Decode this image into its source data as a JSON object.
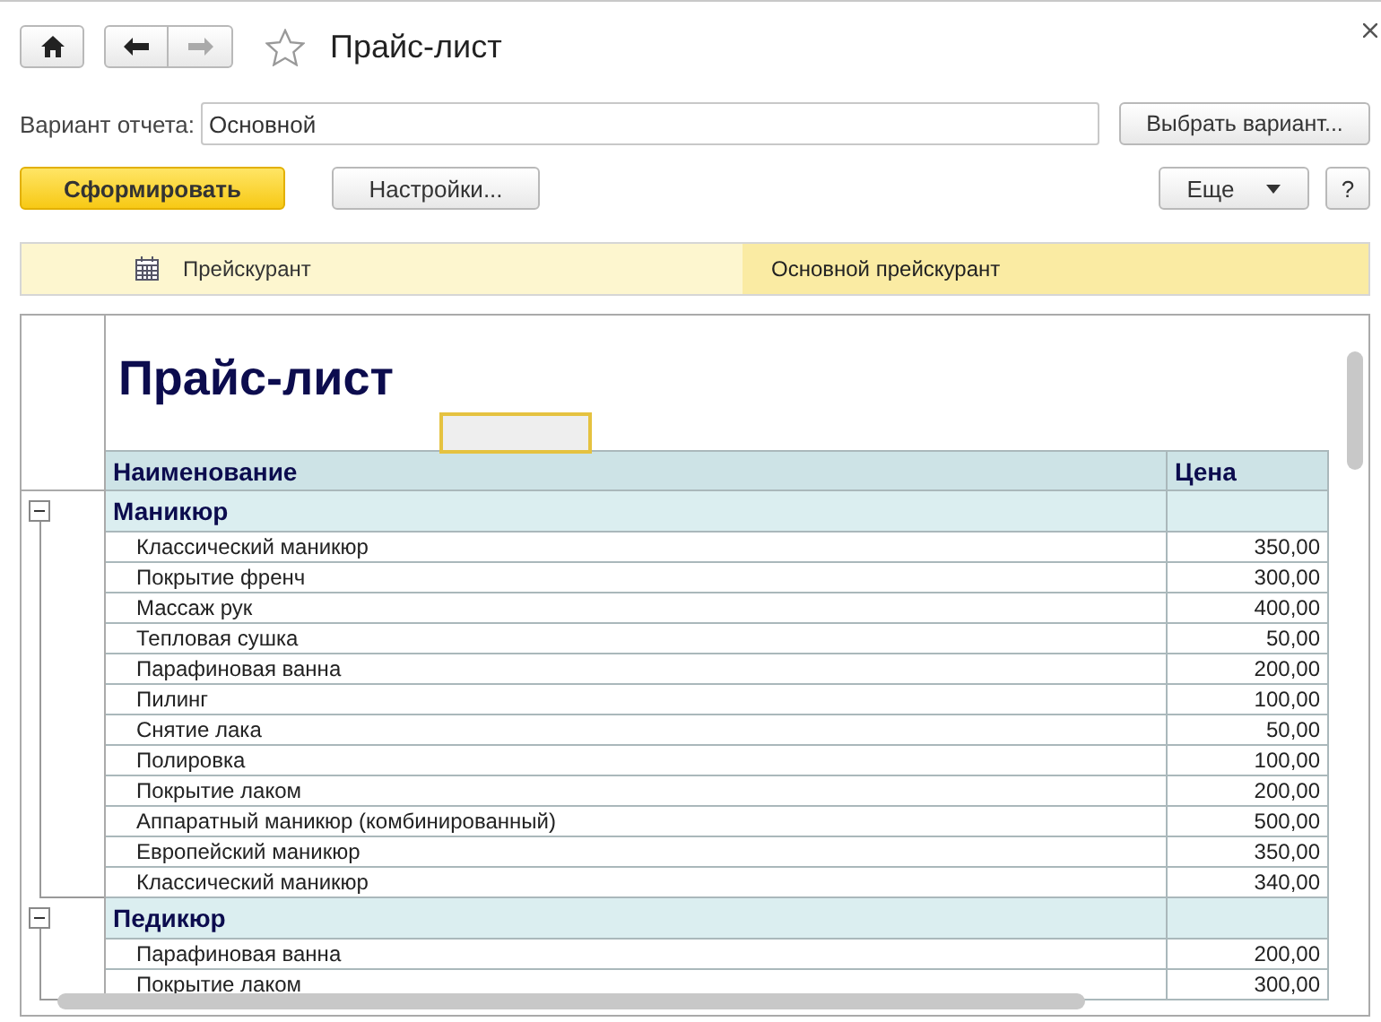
{
  "window": {
    "title": "Прайс-лист",
    "favorite": false
  },
  "nav": [
    {
      "kind": "back",
      "disabled": false
    },
    {
      "kind": "forward",
      "disabled": true
    }
  ],
  "variant": {
    "label": "Вариант отчета:",
    "value": "Основной",
    "button": "Выбрать вариант..."
  },
  "actions": {
    "generate": "Сформировать",
    "settings": "Настройки...",
    "more": "Еще",
    "help": "?"
  },
  "settings_strip": {
    "label": "Прейскурант",
    "value": "Основной прейскурант"
  },
  "report": {
    "title": "Прайс-лист",
    "columns": [
      "Наименование",
      "Цена"
    ],
    "groups": [
      {
        "name": "Маникюр",
        "expanded": true,
        "items": [
          {
            "name": "Классический маникюр",
            "price": "350,00"
          },
          {
            "name": "Покрытие френч",
            "price": "300,00"
          },
          {
            "name": "Массаж рук",
            "price": "400,00"
          },
          {
            "name": "Тепловая сушка",
            "price": "50,00"
          },
          {
            "name": "Парафиновая ванна",
            "price": "200,00"
          },
          {
            "name": "Пилинг",
            "price": "100,00"
          },
          {
            "name": "Снятие лака",
            "price": "50,00"
          },
          {
            "name": "Полировка",
            "price": "100,00"
          },
          {
            "name": "Покрытие лаком",
            "price": "200,00"
          },
          {
            "name": "Аппаратный маникюр (комбинированный)",
            "price": "500,00"
          },
          {
            "name": "Европейский маникюр",
            "price": "350,00"
          },
          {
            "name": "Классический маникюр",
            "price": "340,00"
          }
        ]
      },
      {
        "name": "Педикюр",
        "expanded": true,
        "items": [
          {
            "name": "Парафиновая ванна",
            "price": "200,00"
          },
          {
            "name": "Покрытие лаком",
            "price": "300,00"
          }
        ]
      }
    ]
  }
}
